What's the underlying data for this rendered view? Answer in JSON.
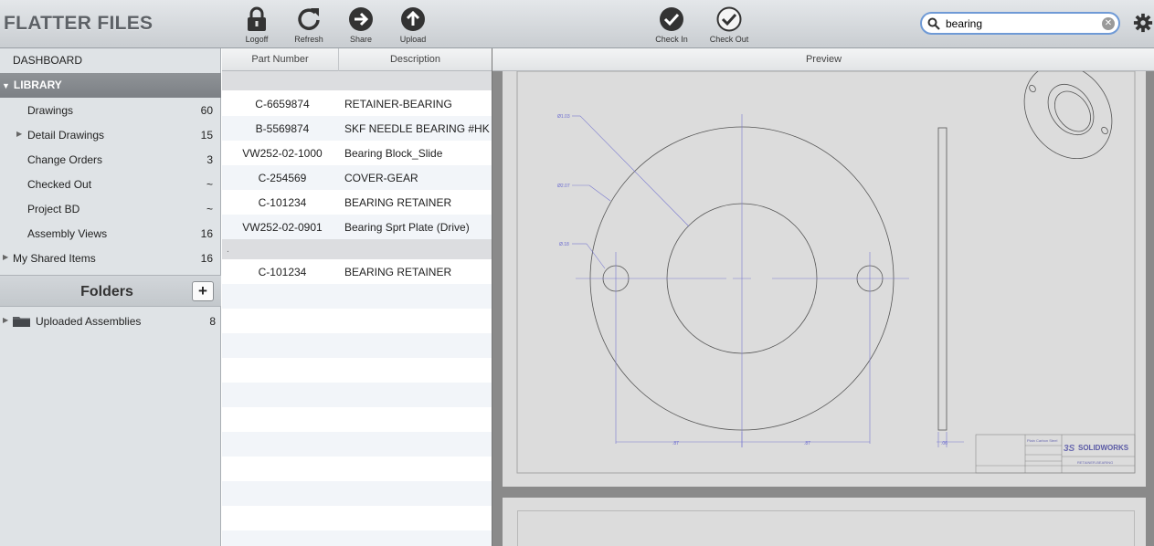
{
  "app": {
    "title": "FLATTER FILES"
  },
  "toolbar": {
    "buttons": [
      {
        "label": "Logoff",
        "icon": "lock-icon"
      },
      {
        "label": "Refresh",
        "icon": "refresh-icon"
      },
      {
        "label": "Share",
        "icon": "share-arrow-icon"
      },
      {
        "label": "Upload",
        "icon": "upload-icon"
      },
      {
        "label": "Check In",
        "icon": "check-in-icon"
      },
      {
        "label": "Check Out",
        "icon": "check-out-icon"
      }
    ],
    "search_value": "bearing",
    "settings_icon": "gear-icon"
  },
  "sidebar": {
    "dashboard": "DASHBOARD",
    "library_label": "LIBRARY",
    "items": [
      {
        "label": "Drawings",
        "count": "60"
      },
      {
        "label": "Detail Drawings",
        "count": "15",
        "expandable": true
      },
      {
        "label": "Change Orders",
        "count": "3"
      },
      {
        "label": "Checked Out",
        "count": "~"
      },
      {
        "label": "Project BD",
        "count": "~"
      },
      {
        "label": "Assembly Views",
        "count": "16"
      }
    ],
    "shared": {
      "label": "My Shared Items",
      "count": "16"
    },
    "folders_title": "Folders",
    "add_folder_label": "+",
    "folders": [
      {
        "label": "Uploaded Assemblies",
        "count": "8"
      }
    ]
  },
  "list": {
    "columns": [
      "Part Number",
      "Description"
    ],
    "rows": [
      {
        "part": "C-6659874",
        "desc": "RETAINER-BEARING"
      },
      {
        "part": "B-5569874",
        "desc": "SKF NEEDLE BEARING #HK"
      },
      {
        "part": "VW252-02-1000",
        "desc": "Bearing Block_Slide"
      },
      {
        "part": "C-254569",
        "desc": "COVER-GEAR"
      },
      {
        "part": "C-101234",
        "desc": "BEARING RETAINER"
      },
      {
        "part": "VW252-02-0901",
        "desc": "Bearing Sprt  Plate (Drive)"
      }
    ],
    "group2_marker": ".",
    "rows2": [
      {
        "part": "C-101234",
        "desc": "BEARING RETAINER"
      }
    ]
  },
  "preview": {
    "header": "Preview",
    "drawing": {
      "dims": [
        "Ø1.03",
        "Ø2.07",
        "Ø.18",
        ".87",
        ".87",
        ".06"
      ],
      "logo_text": "SOLIDWORKS",
      "logo_prefix": "3S",
      "title_block_name": "RETAINER-BEARING",
      "title_block_material": "Plain Carbon Steel"
    }
  }
}
